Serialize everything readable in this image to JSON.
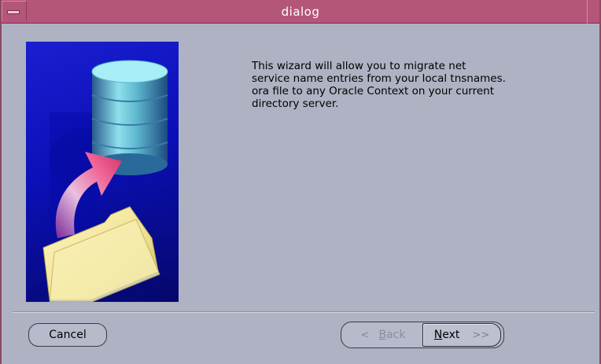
{
  "window": {
    "title": "dialog"
  },
  "message": "This wizard will allow you to migrate net\nservice name entries from your local tnsnames.\nora file to any Oracle Context on your current\ndirectory server.",
  "buttons": {
    "cancel_label": "Cancel",
    "back_mnemonic": "B",
    "back_rest": "ack",
    "back_icon": "<",
    "next_mnemonic": "N",
    "next_rest": "ext",
    "next_icon": ">>"
  },
  "illustration": {
    "name": "database-folder-migration-graphic",
    "colors": {
      "background": "#0b10b8",
      "cylinder": "#6ec8d8",
      "arrow": "#e85a8a",
      "folder": "#f0e6a0"
    }
  }
}
